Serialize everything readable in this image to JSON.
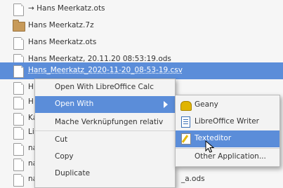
{
  "files": [
    {
      "name": "→ Hans Meerkatz.ots",
      "icon": "file-icon",
      "selected": false
    },
    {
      "name": "Hans Meerkatz.7z",
      "icon": "folder-icon",
      "selected": false
    },
    {
      "name": "Hans Meerkatz.ots",
      "icon": "file-icon",
      "selected": false
    },
    {
      "name": "Hans Meerkatz, 20.11.20 08:53:19.ods",
      "icon": "file-icon",
      "selected": false
    },
    {
      "name": "Hans_Meerkatz_2020-11-20_08-53-19.csv",
      "icon": "file-icon",
      "selected": true
    },
    {
      "name": "H",
      "icon": "file-icon",
      "selected": false
    },
    {
      "name": "H",
      "icon": "file-icon",
      "selected": false
    },
    {
      "name": "Ka",
      "icon": "file-icon",
      "selected": false
    },
    {
      "name": "Li",
      "icon": "file-icon",
      "selected": false
    },
    {
      "name": "na",
      "icon": "file-icon",
      "selected": false
    },
    {
      "name": "na",
      "icon": "file-icon",
      "selected": false
    },
    {
      "name": "na",
      "icon": "file-icon",
      "selected": false
    }
  ],
  "partial_texts": {
    "row9_tail": "_a.ods"
  },
  "context_menu": {
    "open_with_calc": "Open With LibreOffice Calc",
    "open_with": "Open With",
    "relative_links": "Mache Verknüpfungen relativ",
    "cut": "Cut",
    "copy": "Copy",
    "duplicate": "Duplicate"
  },
  "submenu": {
    "geany": "Geany",
    "writer": "LibreOffice Writer",
    "texteditor": "Texteditor",
    "other": "Other Application..."
  },
  "colors": {
    "accent": "#5b8dd9"
  }
}
